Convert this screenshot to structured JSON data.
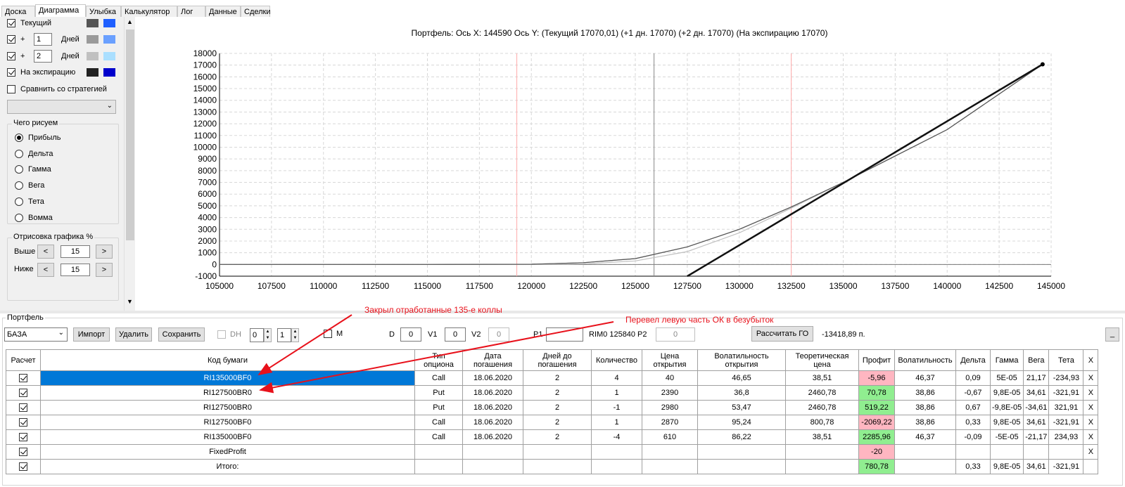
{
  "tabs": [
    {
      "label": "Доска"
    },
    {
      "label": "Диаграмма"
    },
    {
      "label": "Улыбка"
    },
    {
      "label": "Калькулятор"
    },
    {
      "label": "Лог"
    },
    {
      "label": "Данные"
    },
    {
      "label": "Сделки"
    }
  ],
  "active_tab": "Диаграмма",
  "left": {
    "current_label": "Текущий",
    "plus": "+",
    "day1": "1",
    "day2": "2",
    "days_label": "Дней",
    "expiry_label": "На экспирацию",
    "compare_label": "Сравнить со стратегией",
    "what_group": "Чего рисуем",
    "radios": [
      "Прибыль",
      "Дельта",
      "Гамма",
      "Вега",
      "Тета",
      "Вомма"
    ],
    "selected_radio": "Прибыль",
    "draw_group": "Отрисовка графика %",
    "above_label": "Выше",
    "below_label": "Ниже",
    "above_value": "15",
    "below_value": "15",
    "prev": "<",
    "next": ">",
    "colors": {
      "current": [
        "#555555",
        "#1f5fff"
      ],
      "day1": [
        "#9a9a9a",
        "#6aa0ff"
      ],
      "day2": [
        "#c0c0c0",
        "#aadfff"
      ],
      "expiry": [
        "#222222",
        "#0000cc"
      ]
    }
  },
  "chart": {
    "title": "Портфель: Ось X:  144590 Ось Y:   (Текущий 17070,01)  (+1 дн. 17070)  (+2 дн. 17070)  (На экспирацию 17070)"
  },
  "chart_data": {
    "type": "line",
    "xlim": [
      105000,
      145000
    ],
    "ylim": [
      -1000,
      18000
    ],
    "xticks": [
      105000,
      107500,
      110000,
      112500,
      115000,
      117500,
      120000,
      122500,
      125000,
      127500,
      130000,
      132500,
      135000,
      137500,
      140000,
      142500,
      145000
    ],
    "yticks": [
      -1000,
      0,
      1000,
      2000,
      3000,
      4000,
      5000,
      6000,
      7000,
      8000,
      9000,
      10000,
      11000,
      12000,
      13000,
      14000,
      15000,
      16000,
      17000,
      18000
    ],
    "grid": true,
    "vlines": [
      {
        "x": 119300,
        "color": "#ffaaaa"
      },
      {
        "x": 125900,
        "color": "#888888"
      },
      {
        "x": 132500,
        "color": "#ffaaaa"
      }
    ],
    "series": [
      {
        "color": "#9a9a9a",
        "x": [
          105000,
          115000,
          120000,
          122500,
          125000,
          127500,
          130000,
          132500,
          135000,
          140000,
          144590
        ],
        "y": [
          0,
          0,
          20,
          150,
          500,
          1500,
          3000,
          4900,
          7000,
          11500,
          17070
        ]
      },
      {
        "color": "#c0c0c0",
        "x": [
          105000,
          115000,
          120000,
          122500,
          125000,
          127500,
          130000,
          132500,
          135000,
          140000,
          144590
        ],
        "y": [
          0,
          0,
          0,
          50,
          300,
          1100,
          2700,
          4800,
          7000,
          11500,
          17070
        ]
      },
      {
        "color": "#555555",
        "x": [
          105000,
          115000,
          120000,
          122500,
          125000,
          127500,
          130000,
          132500,
          135000,
          140000,
          144590
        ],
        "y": [
          0,
          0,
          20,
          150,
          500,
          1500,
          3000,
          4900,
          7000,
          11500,
          17070
        ]
      },
      {
        "color": "#111111",
        "x": [
          127500,
          144590
        ],
        "y": [
          -1000,
          17070
        ]
      }
    ],
    "end_point": {
      "x": 144590,
      "y": 17070
    }
  },
  "portfolio": {
    "group": "Портфель",
    "name": "БАЗА",
    "import": "Импорт",
    "delete": "Удалить",
    "save": "Сохранить",
    "dh": "DH",
    "dh_v1": "0",
    "dh_v2": "1",
    "m": "M",
    "d_label": "D",
    "d_val": "0",
    "v1_label": "V1",
    "v1_val": "0",
    "v2_label": "V2",
    "v2_val": "0",
    "p1_label": "P1",
    "p1_val": "",
    "underlying": "RIM0 125840",
    "p2_label": "P2",
    "p2_val": "0",
    "calc_go": "Рассчитать ГО",
    "go_value": "-13418,89 п.",
    "min_btn": "_"
  },
  "annotations": {
    "a1": "Закрыл отработанные 135-е коллы",
    "a2": "Перевел левую часть ОК в безубыток"
  },
  "table": {
    "headers": [
      "Расчет",
      "Код бумаги",
      "Тип опциона",
      "Дата погашения",
      "Дней до погашения",
      "Количество",
      "Цена открытия",
      "Волатильность открытия",
      "Теоретическая цена",
      "Профит",
      "Волатильность",
      "Дельта",
      "Гамма",
      "Вега",
      "Тета",
      "X"
    ],
    "rows": [
      {
        "code": "RI135000BF0",
        "type": "Call",
        "date": "18.06.2020",
        "days": "2",
        "qty": "4",
        "price": "40",
        "vol_open": "46,65",
        "theor": "38,51",
        "profit": "-5,96",
        "vol": "46,37",
        "delta": "0,09",
        "gamma": "5E-05",
        "vega": "21,17",
        "theta": "-234,93",
        "x": "X"
      },
      {
        "code": "RI127500BR0",
        "type": "Put",
        "date": "18.06.2020",
        "days": "2",
        "qty": "1",
        "price": "2390",
        "vol_open": "36,8",
        "theor": "2460,78",
        "profit": "70,78",
        "vol": "38,86",
        "delta": "-0,67",
        "gamma": "9,8E-05",
        "vega": "34,61",
        "theta": "-321,91",
        "x": "X"
      },
      {
        "code": "RI127500BR0",
        "type": "Put",
        "date": "18.06.2020",
        "days": "2",
        "qty": "-1",
        "price": "2980",
        "vol_open": "53,47",
        "theor": "2460,78",
        "profit": "519,22",
        "vol": "38,86",
        "delta": "0,67",
        "gamma": "-9,8E-05",
        "vega": "-34,61",
        "theta": "321,91",
        "x": "X"
      },
      {
        "code": "RI127500BF0",
        "type": "Call",
        "date": "18.06.2020",
        "days": "2",
        "qty": "1",
        "price": "2870",
        "vol_open": "95,24",
        "theor": "800,78",
        "profit": "-2069,22",
        "vol": "38,86",
        "delta": "0,33",
        "gamma": "9,8E-05",
        "vega": "34,61",
        "theta": "-321,91",
        "x": "X"
      },
      {
        "code": "RI135000BF0",
        "type": "Call",
        "date": "18.06.2020",
        "days": "2",
        "qty": "-4",
        "price": "610",
        "vol_open": "86,22",
        "theor": "38,51",
        "profit": "2285,96",
        "vol": "46,37",
        "delta": "-0,09",
        "gamma": "-5E-05",
        "vega": "-21,17",
        "theta": "234,93",
        "x": "X"
      },
      {
        "code": "FixedProfit",
        "type": "",
        "date": "",
        "days": "",
        "qty": "",
        "price": "",
        "vol_open": "",
        "theor": "",
        "profit": "-20",
        "vol": "",
        "delta": "",
        "gamma": "",
        "vega": "",
        "theta": "",
        "x": "X"
      },
      {
        "code": "Итого:",
        "type": "",
        "date": "",
        "days": "",
        "qty": "",
        "price": "",
        "vol_open": "",
        "theor": "",
        "profit": "780,78",
        "vol": "",
        "delta": "0,33",
        "gamma": "9,8E-05",
        "vega": "34,61",
        "theta": "-321,91",
        "x": ""
      }
    ]
  }
}
